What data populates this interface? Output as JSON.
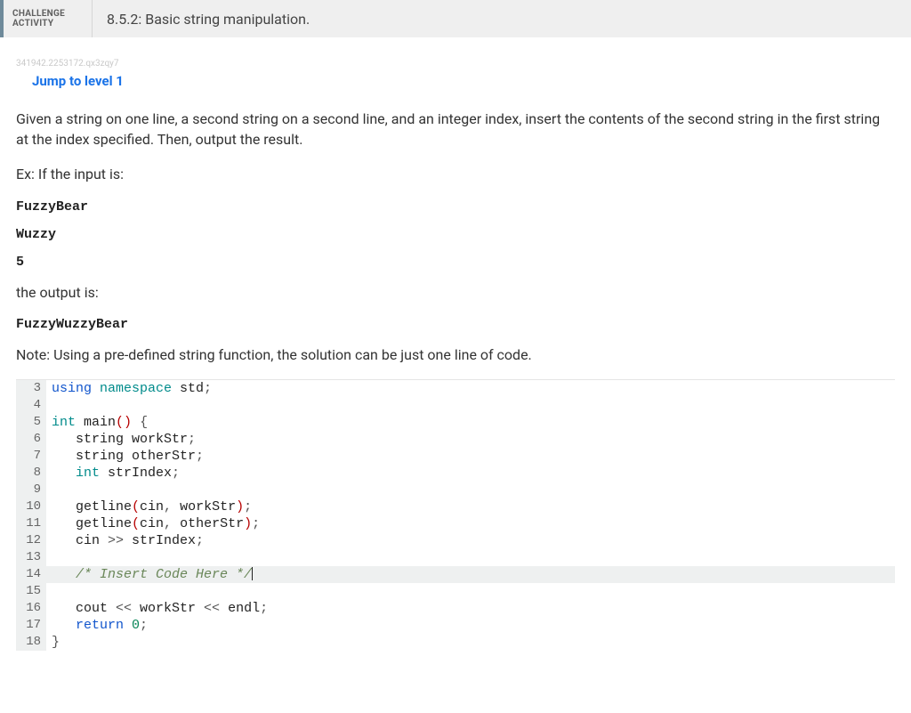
{
  "header": {
    "label": "CHALLENGE ACTIVITY",
    "title": "8.5.2: Basic string manipulation."
  },
  "tiny_id": "341942.2253172.qx3zqy7",
  "jump_link": "Jump to level 1",
  "prose": {
    "p1": "Given a string on one line, a second string on a second line, and an integer index, insert the contents of the second string in the first string at the index specified. Then, output the result.",
    "p2": "Ex: If the input is:",
    "in1": "FuzzyBear",
    "in2": "Wuzzy",
    "in3": "5",
    "p3": "the output is:",
    "out1": "FuzzyWuzzyBear",
    "p4": "Note: Using a pre-defined string function, the solution can be just one line of code."
  },
  "code": {
    "lines": [
      {
        "n": "3",
        "tokens": [
          [
            "kw-blue",
            "using "
          ],
          [
            "kw-teal",
            "namespace "
          ],
          [
            "ident",
            "std"
          ],
          [
            "punct",
            ";"
          ]
        ]
      },
      {
        "n": "4",
        "tokens": []
      },
      {
        "n": "5",
        "tokens": [
          [
            "kw-teal",
            "int "
          ],
          [
            "ident",
            "main"
          ],
          [
            "bracket-red",
            "()"
          ],
          [
            "ident",
            " "
          ],
          [
            "punct",
            "{"
          ]
        ]
      },
      {
        "n": "6",
        "tokens": [
          [
            "ident",
            "   string workStr"
          ],
          [
            "punct",
            ";"
          ]
        ]
      },
      {
        "n": "7",
        "tokens": [
          [
            "ident",
            "   string otherStr"
          ],
          [
            "punct",
            ";"
          ]
        ]
      },
      {
        "n": "8",
        "tokens": [
          [
            "kw-teal",
            "   int "
          ],
          [
            "ident",
            "strIndex"
          ],
          [
            "punct",
            ";"
          ]
        ]
      },
      {
        "n": "9",
        "tokens": []
      },
      {
        "n": "10",
        "tokens": [
          [
            "ident",
            "   getline"
          ],
          [
            "bracket-red",
            "("
          ],
          [
            "ident",
            "cin"
          ],
          [
            "punct",
            ", "
          ],
          [
            "ident",
            "workStr"
          ],
          [
            "bracket-red",
            ")"
          ],
          [
            "punct",
            ";"
          ]
        ]
      },
      {
        "n": "11",
        "tokens": [
          [
            "ident",
            "   getline"
          ],
          [
            "bracket-red",
            "("
          ],
          [
            "ident",
            "cin"
          ],
          [
            "punct",
            ", "
          ],
          [
            "ident",
            "otherStr"
          ],
          [
            "bracket-red",
            ")"
          ],
          [
            "punct",
            ";"
          ]
        ]
      },
      {
        "n": "12",
        "tokens": [
          [
            "ident",
            "   cin "
          ],
          [
            "punct",
            ">> "
          ],
          [
            "ident",
            "strIndex"
          ],
          [
            "punct",
            ";"
          ]
        ]
      },
      {
        "n": "13",
        "tokens": []
      },
      {
        "n": "14",
        "hl": true,
        "tokens": [
          [
            "comment",
            "   /* Insert Code Here */"
          ]
        ],
        "caret": true
      },
      {
        "n": "15",
        "tokens": []
      },
      {
        "n": "16",
        "tokens": [
          [
            "ident",
            "   cout "
          ],
          [
            "punct",
            "<< "
          ],
          [
            "ident",
            "workStr "
          ],
          [
            "punct",
            "<< "
          ],
          [
            "ident",
            "endl"
          ],
          [
            "punct",
            ";"
          ]
        ]
      },
      {
        "n": "17",
        "tokens": [
          [
            "kw-blue",
            "   return "
          ],
          [
            "num",
            "0"
          ],
          [
            "punct",
            ";"
          ]
        ]
      },
      {
        "n": "18",
        "tokens": [
          [
            "punct",
            "}"
          ]
        ]
      }
    ]
  }
}
